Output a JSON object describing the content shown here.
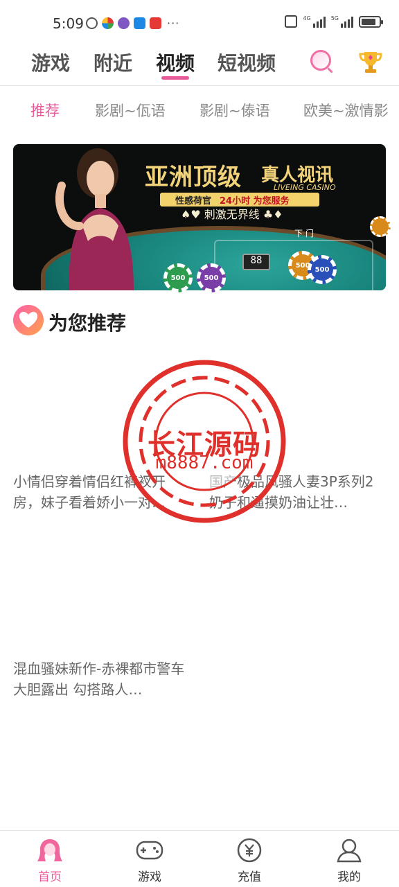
{
  "status_bar": {
    "time": "5:09",
    "overflow": "···",
    "net_1": "4G",
    "net_2": "5G"
  },
  "top_nav": {
    "tabs": [
      {
        "label": "游戏",
        "active": false
      },
      {
        "label": "附近",
        "active": false
      },
      {
        "label": "视频",
        "active": true
      },
      {
        "label": "短视频",
        "active": false
      }
    ],
    "search_icon": "search-icon",
    "rank_icon": "trophy-icon"
  },
  "sub_tabs": {
    "items": [
      {
        "label": "推荐",
        "active": true
      },
      {
        "label": "影剧~佤语",
        "active": false
      },
      {
        "label": "影剧~傣语",
        "active": false
      },
      {
        "label": "欧美~激情影",
        "active": false
      }
    ]
  },
  "banner": {
    "title_main": "亚洲顶级",
    "title_tail": "真人视讯",
    "title_en": "LIVEING CASINO",
    "ribbon_left": "性感荷官",
    "ribbon_right": "24小时 为您服务",
    "slogan": "♠♥ 刺激无界线 ♣♦",
    "chip_value": "500",
    "dial": "88",
    "table_label": "下 门"
  },
  "section": {
    "title": "为您推荐",
    "icon": "heart-icon"
  },
  "videos": [
    {
      "title": "小情侣穿着情侣红裤衩开房，妹子看着娇小一对…"
    },
    {
      "title": "国产极品风骚人妻3P系列2 奶子和逼摸奶油让壮…"
    },
    {
      "title": "混血骚妹新作-赤裸都市警车大胆露出 勾搭路人…"
    }
  ],
  "watermark": {
    "name": "长江源码",
    "url": "m8887.com"
  },
  "bottom_nav": {
    "items": [
      {
        "label": "首页",
        "icon": "home-girl-icon",
        "active": true
      },
      {
        "label": "游戏",
        "icon": "gamepad-icon",
        "active": false
      },
      {
        "label": "充值",
        "icon": "yuan-coin-icon",
        "active": false
      },
      {
        "label": "我的",
        "icon": "user-icon",
        "active": false
      }
    ]
  },
  "colors": {
    "accent": "#e85a9a",
    "watermark_red": "#e0302b"
  }
}
